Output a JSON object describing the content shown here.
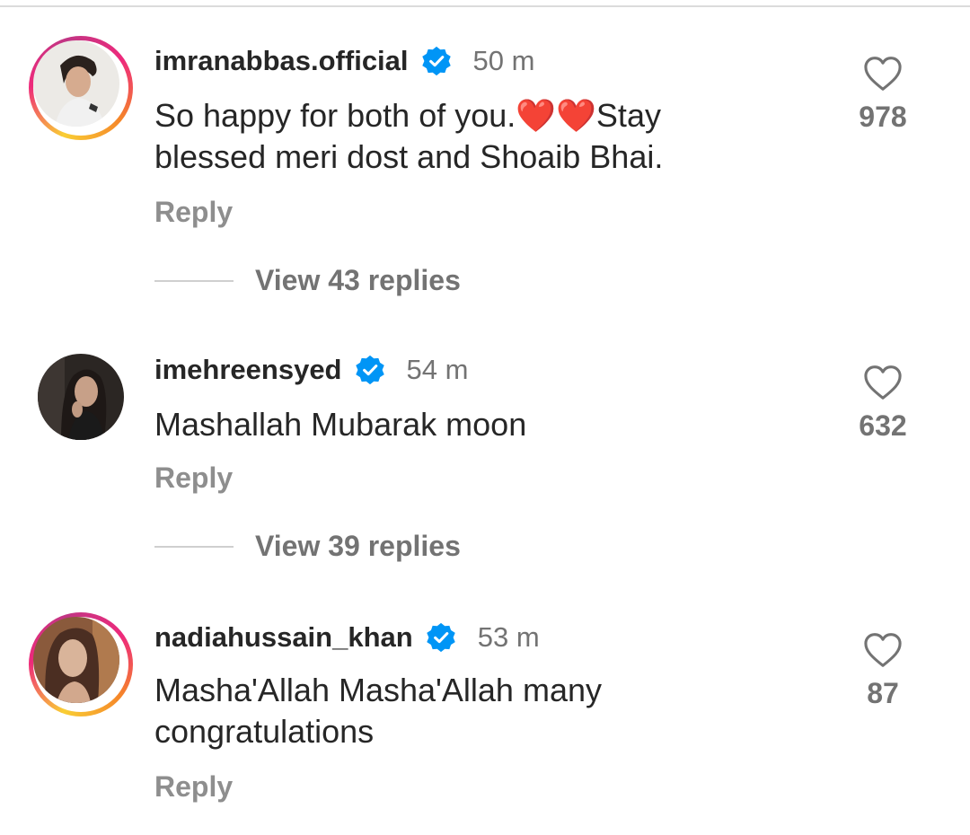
{
  "comments": [
    {
      "username": "imranabbas.official",
      "time": "50 m",
      "text_line1": "So happy for both of you.❤️❤️Stay",
      "text_line2": "blessed meri dost and Shoaib Bhai.",
      "reply_label": "Reply",
      "likes": "978",
      "view_replies": "View 43 replies",
      "avatar_ring": true
    },
    {
      "username": "imehreensyed",
      "time": "54 m",
      "text_line1": "Mashallah Mubarak moon",
      "reply_label": "Reply",
      "likes": "632",
      "view_replies": "View 39 replies",
      "avatar_ring": false
    },
    {
      "username": "nadiahussain_khan",
      "time": "53 m",
      "text_line1": "Masha'Allah  Masha'Allah many",
      "text_line2": "congratulations",
      "reply_label": "Reply",
      "likes": "87",
      "avatar_ring": true
    }
  ],
  "icons": {
    "verified": "verified-badge-icon",
    "like": "heart-outline-icon"
  },
  "colors": {
    "verified_blue": "#0095f6",
    "secondary_text": "#737373",
    "primary_text": "#262626"
  }
}
